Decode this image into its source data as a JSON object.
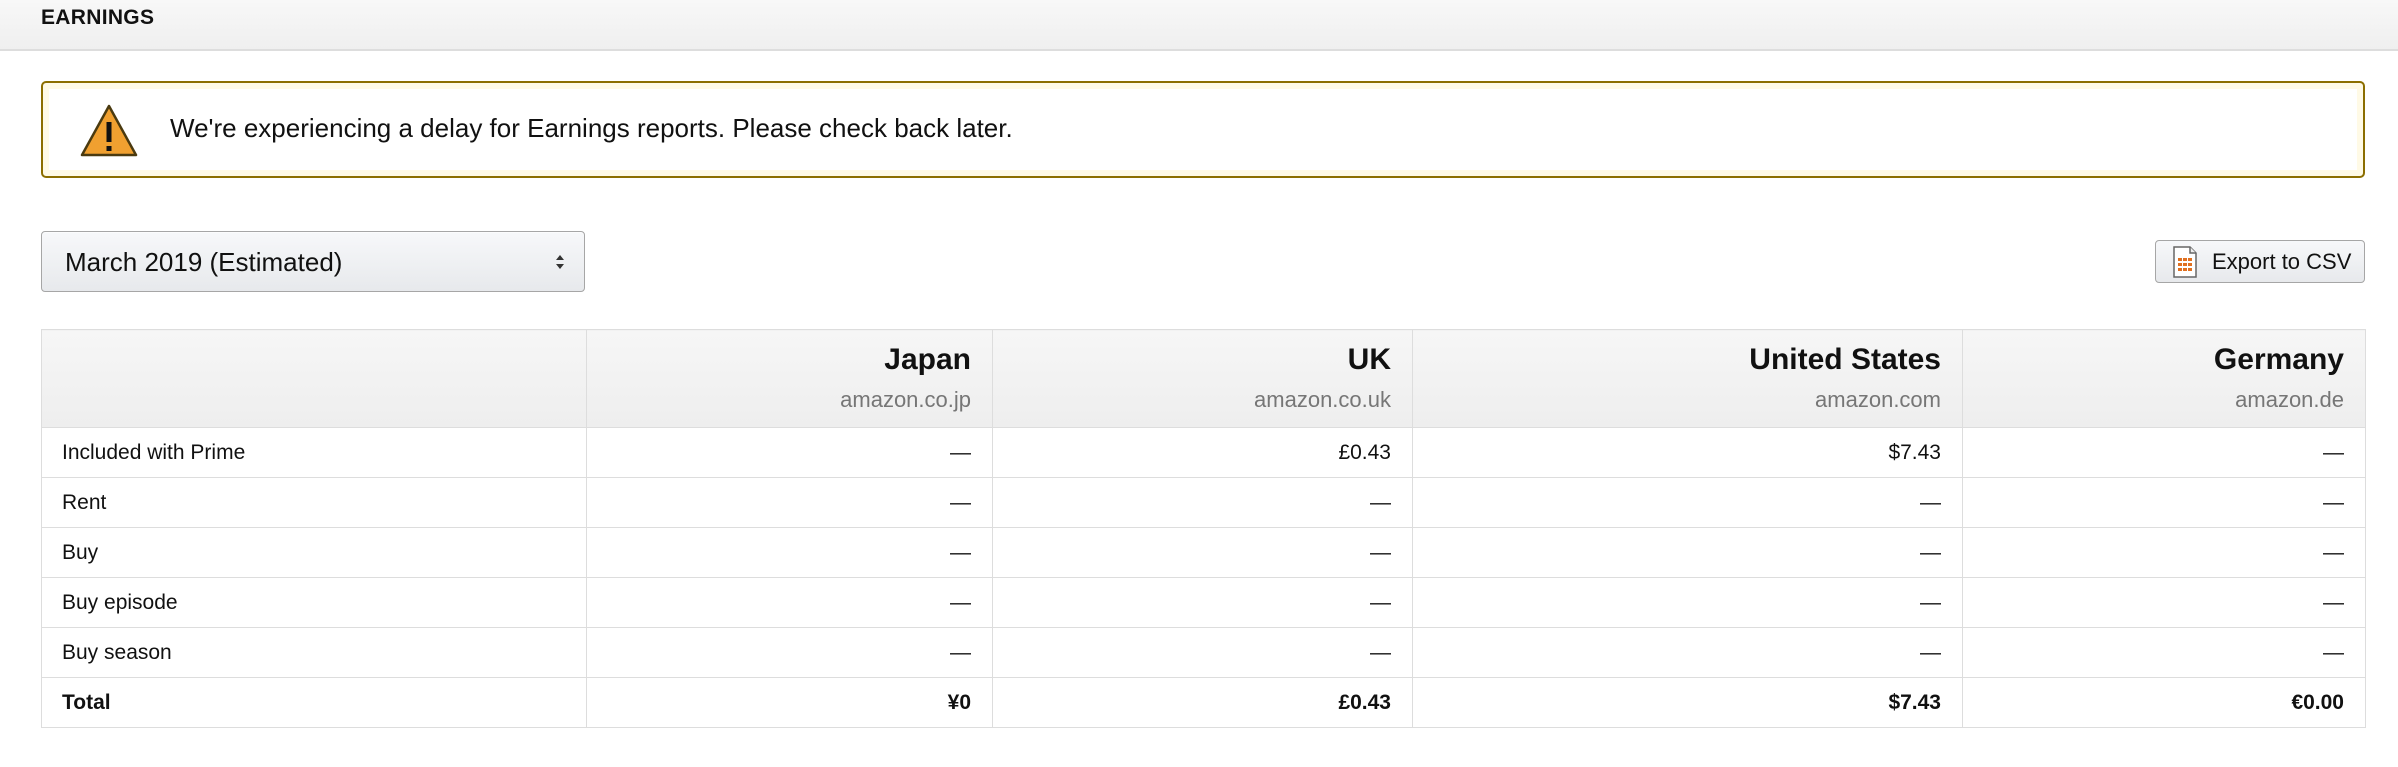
{
  "header": {
    "title": "EARNINGS"
  },
  "alert": {
    "icon": "warning-icon",
    "message": "We're experiencing a delay for Earnings reports. Please check back later.",
    "icon_color": "#f0a030"
  },
  "period_select": {
    "selected": "March 2019 (Estimated)"
  },
  "export_button": {
    "icon": "csv-file-icon",
    "label": "Export to CSV"
  },
  "table": {
    "columns": [
      {
        "name": "Japan",
        "domain": "amazon.co.jp"
      },
      {
        "name": "UK",
        "domain": "amazon.co.uk"
      },
      {
        "name": "United States",
        "domain": "amazon.com"
      },
      {
        "name": "Germany",
        "domain": "amazon.de"
      }
    ],
    "rows": [
      {
        "label": "Included with Prime",
        "values": [
          "—",
          "£0.43",
          "$7.43",
          "—"
        ]
      },
      {
        "label": "Rent",
        "values": [
          "—",
          "—",
          "—",
          "—"
        ]
      },
      {
        "label": "Buy",
        "values": [
          "—",
          "—",
          "—",
          "—"
        ]
      },
      {
        "label": "Buy episode",
        "values": [
          "—",
          "—",
          "—",
          "—"
        ]
      },
      {
        "label": "Buy season",
        "values": [
          "—",
          "—",
          "—",
          "—"
        ]
      }
    ],
    "total": {
      "label": "Total",
      "values": [
        "¥0",
        "£0.43",
        "$7.43",
        "€0.00"
      ]
    }
  }
}
